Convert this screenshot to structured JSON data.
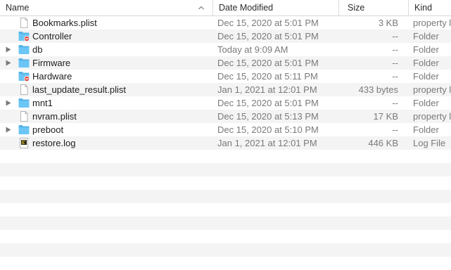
{
  "columns": {
    "name": "Name",
    "date": "Date Modified",
    "size": "Size",
    "kind": "Kind"
  },
  "sort_icon": "chevron-up-icon",
  "rows": [
    {
      "name": "Bookmarks.plist",
      "date": "Dec 15, 2020 at 5:01 PM",
      "size": "3 KB",
      "kind": "property list",
      "icon": "document-icon",
      "expandable": false
    },
    {
      "name": "Controller",
      "date": "Dec 15, 2020 at 5:01 PM",
      "size": "--",
      "kind": "Folder",
      "icon": "restricted-folder-icon",
      "expandable": false
    },
    {
      "name": "db",
      "date": "Today at 9:09 AM",
      "size": "--",
      "kind": "Folder",
      "icon": "folder-icon",
      "expandable": true
    },
    {
      "name": "Firmware",
      "date": "Dec 15, 2020 at 5:01 PM",
      "size": "--",
      "kind": "Folder",
      "icon": "folder-icon",
      "expandable": true
    },
    {
      "name": "Hardware",
      "date": "Dec 15, 2020 at 5:11 PM",
      "size": "--",
      "kind": "Folder",
      "icon": "restricted-folder-icon",
      "expandable": false
    },
    {
      "name": "last_update_result.plist",
      "date": "Jan 1, 2021 at 12:01 PM",
      "size": "433 bytes",
      "kind": "property list",
      "icon": "document-icon",
      "expandable": false
    },
    {
      "name": "mnt1",
      "date": "Dec 15, 2020 at 5:01 PM",
      "size": "--",
      "kind": "Folder",
      "icon": "folder-icon",
      "expandable": true
    },
    {
      "name": "nvram.plist",
      "date": "Dec 15, 2020 at 5:13 PM",
      "size": "17 KB",
      "kind": "property list",
      "icon": "document-icon",
      "expandable": false
    },
    {
      "name": "preboot",
      "date": "Dec 15, 2020 at 5:10 PM",
      "size": "--",
      "kind": "Folder",
      "icon": "folder-icon",
      "expandable": true
    },
    {
      "name": "restore.log",
      "date": "Jan 1, 2021 at 12:01 PM",
      "size": "446 KB",
      "kind": "Log File",
      "icon": "log-file-icon",
      "expandable": false
    }
  ],
  "colors": {
    "folder": "#6cc6f5",
    "folder_tab": "#57b4e6",
    "restricted": "#e0443a",
    "stripe": "#f4f4f4"
  }
}
